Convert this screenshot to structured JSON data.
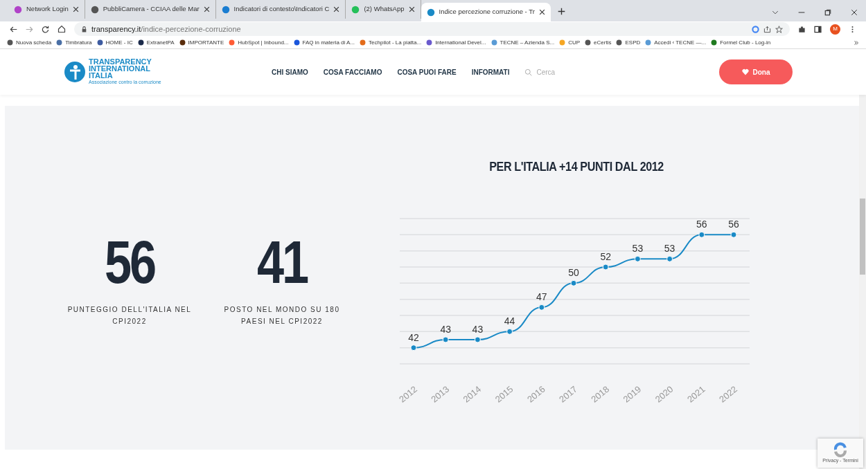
{
  "browser": {
    "tabs": [
      {
        "title": "Network Login",
        "selected": false
      },
      {
        "title": "PubbliCamera - CCIAA delle Mar",
        "selected": false
      },
      {
        "title": "Indicatori di contesto\\Indicatori C",
        "selected": false
      },
      {
        "title": "(2) WhatsApp",
        "selected": false
      },
      {
        "title": "Indice percezione corruzione - Tr",
        "selected": true
      }
    ],
    "address": {
      "domain": "transparency.it",
      "path": "/indice-percezione-corruzione"
    },
    "profile_initial": "M",
    "bookmarks": [
      "Nuova scheda",
      "Timbratura",
      "HOME - IC",
      "ExtranetPA",
      "IMPORTANTE",
      "HubSpot | Inbound...",
      "FAQ in materia di A...",
      "Techpilot - La piatta...",
      "International Devel...",
      "TECNE – Azienda S...",
      "CUP",
      "eCertis",
      "ESPD",
      "Accedi ‹ TECNE —...",
      "Formel Club - Log-in"
    ]
  },
  "site_header": {
    "logo": {
      "line1": "TRANSPARENCY",
      "line2": "INTERNATIONAL",
      "line3": "ITALIA",
      "tagline": "Associazione contro la corruzione"
    },
    "nav": [
      "CHI SIAMO",
      "COSA FACCIAMO",
      "COSA PUOI FARE",
      "INFORMATI"
    ],
    "search": {
      "placeholder": "Cerca"
    },
    "donate_button": "Dona"
  },
  "stats": [
    {
      "value": "56",
      "label": "PUNTEGGIO DELL'ITALIA NEL CPI2022"
    },
    {
      "value": "41",
      "label": "POSTO NEL MONDO SU 180 PAESI NEL CPI2022"
    }
  ],
  "chart": {
    "chart_data": {
      "type": "line",
      "title": "PER L'ITALIA +14 PUNTI DAL 2012",
      "categories": [
        "2012",
        "2013",
        "2014",
        "2015",
        "2016",
        "2017",
        "2018",
        "2019",
        "2020",
        "2021",
        "2022"
      ],
      "series": [
        {
          "color": "#1a8ac6",
          "marker": "circle",
          "values": [
            42,
            43,
            43,
            44,
            47,
            50,
            52,
            53,
            53,
            56,
            56
          ]
        }
      ],
      "ylim": [
        40,
        58
      ],
      "data_labels": true
    }
  },
  "recaptcha": {
    "text": "Privacy - Termini"
  }
}
